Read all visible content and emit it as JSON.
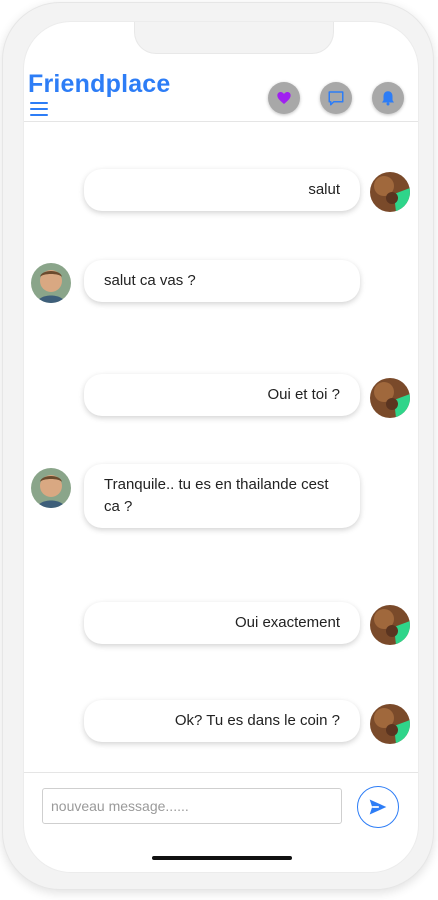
{
  "app": {
    "brand": "Friendplace"
  },
  "header": {
    "icons": [
      "heart-icon",
      "chat-icon",
      "bell-icon"
    ],
    "heart_color": "#a020f0",
    "accent": "#2d7df6"
  },
  "messages": [
    {
      "direction": "out",
      "text": "salut"
    },
    {
      "direction": "in",
      "text": "salut ca vas ?"
    },
    {
      "direction": "out",
      "text": "Oui et toi ?"
    },
    {
      "direction": "in",
      "text": "Tranquile.. tu es en thailande cest ca ?"
    },
    {
      "direction": "out",
      "text": "Oui exactement"
    },
    {
      "direction": "out",
      "text": "Ok? Tu es dans le coin ?"
    }
  ],
  "composer": {
    "placeholder": "nouveau message......",
    "value": ""
  }
}
